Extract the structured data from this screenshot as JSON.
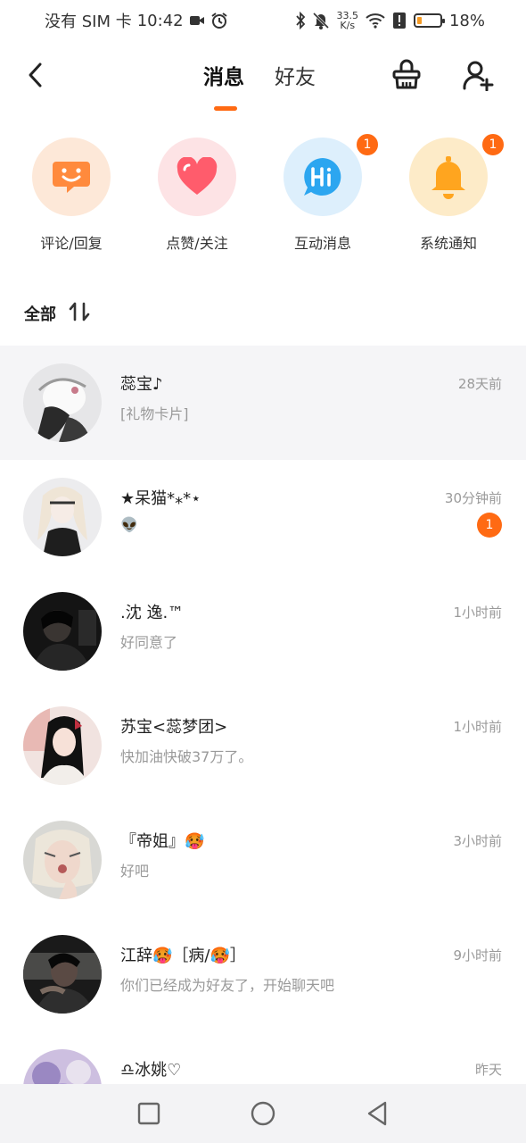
{
  "status_bar": {
    "carrier": "没有 SIM 卡",
    "time": "10:42",
    "speed_value": "33.5",
    "speed_unit": "K/s",
    "battery": "18%",
    "battery_level": 0.18,
    "icons": [
      "video-icon",
      "alarm-icon",
      "bluetooth-icon",
      "mute-bell-icon",
      "wifi-icon",
      "alert-icon",
      "battery-icon"
    ]
  },
  "header": {
    "tabs": [
      {
        "label": "消息",
        "active": true
      },
      {
        "label": "好友",
        "active": false
      }
    ],
    "icons": [
      "back-icon",
      "clean-basket-icon",
      "add-friend-icon"
    ]
  },
  "categories": [
    {
      "label": "评论/回复",
      "icon": "comment-icon",
      "bg": "#fde8d8",
      "color": "#ff8a3d",
      "badge": null
    },
    {
      "label": "点赞/关注",
      "icon": "heart-icon",
      "bg": "#fde3e5",
      "color": "#ff5c6c",
      "badge": null
    },
    {
      "label": "互动消息",
      "icon": "hi-icon",
      "bg": "#ddeffc",
      "color": "#2ca6f0",
      "badge": "1"
    },
    {
      "label": "系统通知",
      "icon": "bell-icon",
      "bg": "#fdebc8",
      "color": "#ffa51f",
      "badge": "1"
    }
  ],
  "section": {
    "title": "全部",
    "sort_icon": "sort-icon"
  },
  "conversations": [
    {
      "name": "蕊宝♪",
      "message": "[礼物卡片]",
      "time": "28天前",
      "badge": null
    },
    {
      "name": "★呆猫*⁎*⋆",
      "message": "👽",
      "time": "30分钟前",
      "badge": "1"
    },
    {
      "name": ".沈 逸.™",
      "message": "好同意了",
      "time": "1小时前",
      "badge": null
    },
    {
      "name": "苏宝<蕊梦团>",
      "message": "快加油快破37万了。",
      "time": "1小时前",
      "badge": null
    },
    {
      "name": "『帝姐』🥵",
      "message": "好吧",
      "time": "3小时前",
      "badge": null
    },
    {
      "name": "江辞🥵［病/🥵］",
      "message": "你们已经成为好友了，开始聊天吧",
      "time": "9小时前",
      "badge": null
    },
    {
      "name": "♎冰姚♡",
      "message": "",
      "time": "昨天",
      "badge": null
    }
  ],
  "nav_bar": {
    "icons": [
      "recent-apps-icon",
      "home-icon",
      "back-nav-icon"
    ]
  }
}
